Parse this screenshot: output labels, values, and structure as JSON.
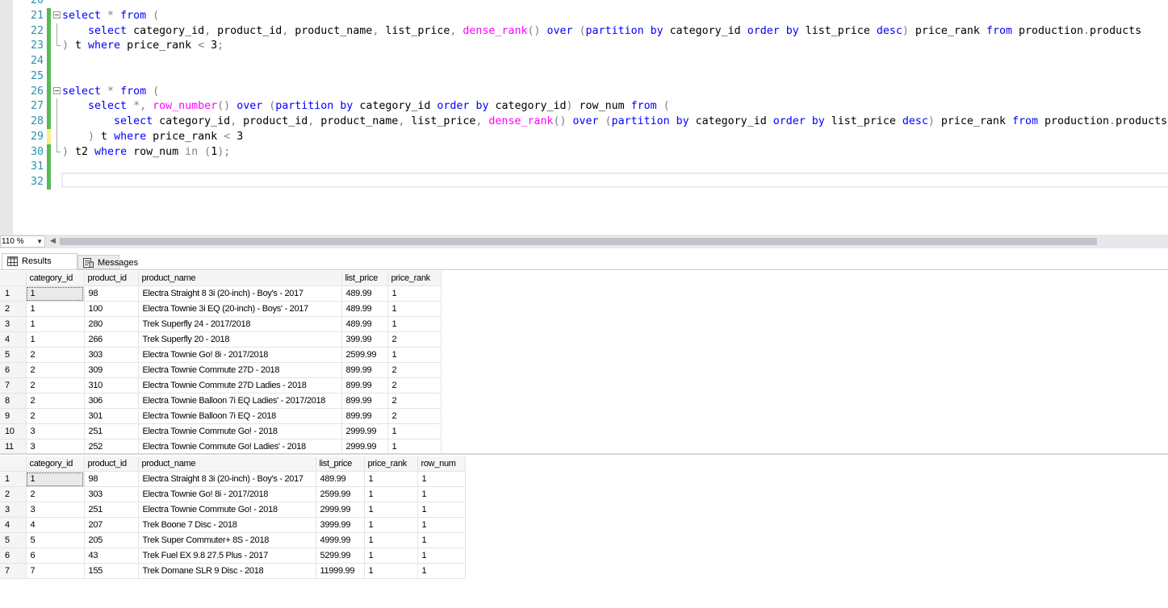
{
  "editor": {
    "lines": [
      {
        "num": "20",
        "tokens": []
      },
      {
        "num": "21",
        "tokens": [
          [
            "kw",
            "select "
          ],
          [
            "op",
            "* "
          ],
          [
            "kw",
            "from "
          ],
          [
            "op",
            "("
          ]
        ]
      },
      {
        "num": "22",
        "tokens": [
          [
            "",
            "    "
          ],
          [
            "kw",
            "select "
          ],
          [
            "",
            "category_id"
          ],
          [
            "op",
            ", "
          ],
          [
            "",
            "product_id"
          ],
          [
            "op",
            ", "
          ],
          [
            "",
            "product_name"
          ],
          [
            "op",
            ", "
          ],
          [
            "",
            "list_price"
          ],
          [
            "op",
            ", "
          ],
          [
            "fn",
            "dense_rank"
          ],
          [
            "op",
            "() "
          ],
          [
            "kw",
            "over "
          ],
          [
            "op",
            "("
          ],
          [
            "kw",
            "partition by "
          ],
          [
            "",
            "category_id "
          ],
          [
            "kw",
            "order by "
          ],
          [
            "",
            "list_price "
          ],
          [
            "kw",
            "desc"
          ],
          [
            "op",
            ") "
          ],
          [
            "",
            "price_rank "
          ],
          [
            "kw",
            "from "
          ],
          [
            "",
            "production"
          ],
          [
            "op",
            "."
          ],
          [
            "",
            "products"
          ]
        ]
      },
      {
        "num": "23",
        "tokens": [
          [
            "op",
            ") "
          ],
          [
            "",
            "t "
          ],
          [
            "kw",
            "where "
          ],
          [
            "",
            "price_rank "
          ],
          [
            "op",
            "< "
          ],
          [
            "",
            "3"
          ],
          [
            "op",
            ";"
          ]
        ]
      },
      {
        "num": "24",
        "tokens": []
      },
      {
        "num": "25",
        "tokens": []
      },
      {
        "num": "26",
        "tokens": [
          [
            "kw",
            "select "
          ],
          [
            "op",
            "* "
          ],
          [
            "kw",
            "from "
          ],
          [
            "op",
            "("
          ]
        ]
      },
      {
        "num": "27",
        "tokens": [
          [
            "",
            "    "
          ],
          [
            "kw",
            "select "
          ],
          [
            "op",
            "*, "
          ],
          [
            "fn",
            "row_number"
          ],
          [
            "op",
            "() "
          ],
          [
            "kw",
            "over "
          ],
          [
            "op",
            "("
          ],
          [
            "kw",
            "partition by "
          ],
          [
            "",
            "category_id "
          ],
          [
            "kw",
            "order by "
          ],
          [
            "",
            "category_id"
          ],
          [
            "op",
            ") "
          ],
          [
            "",
            "row_num "
          ],
          [
            "kw",
            "from "
          ],
          [
            "op",
            "("
          ]
        ]
      },
      {
        "num": "28",
        "tokens": [
          [
            "",
            "        "
          ],
          [
            "kw",
            "select "
          ],
          [
            "",
            "category_id"
          ],
          [
            "op",
            ", "
          ],
          [
            "",
            "product_id"
          ],
          [
            "op",
            ", "
          ],
          [
            "",
            "product_name"
          ],
          [
            "op",
            ", "
          ],
          [
            "",
            "list_price"
          ],
          [
            "op",
            ", "
          ],
          [
            "fn",
            "dense_rank"
          ],
          [
            "op",
            "() "
          ],
          [
            "kw",
            "over "
          ],
          [
            "op",
            "("
          ],
          [
            "kw",
            "partition by "
          ],
          [
            "",
            "category_id "
          ],
          [
            "kw",
            "order by "
          ],
          [
            "",
            "list_price "
          ],
          [
            "kw",
            "desc"
          ],
          [
            "op",
            ") "
          ],
          [
            "",
            "price_rank "
          ],
          [
            "kw",
            "from "
          ],
          [
            "",
            "production"
          ],
          [
            "op",
            "."
          ],
          [
            "",
            "products"
          ]
        ]
      },
      {
        "num": "29",
        "tokens": [
          [
            "",
            "    "
          ],
          [
            "op",
            ") "
          ],
          [
            "",
            "t "
          ],
          [
            "kw",
            "where "
          ],
          [
            "",
            "price_rank "
          ],
          [
            "op",
            "< "
          ],
          [
            "",
            "3"
          ]
        ]
      },
      {
        "num": "30",
        "tokens": [
          [
            "op",
            ") "
          ],
          [
            "",
            "t2 "
          ],
          [
            "kw",
            "where "
          ],
          [
            "",
            "row_num "
          ],
          [
            "op",
            "in "
          ],
          [
            "op",
            "("
          ],
          [
            "",
            "1"
          ],
          [
            "op",
            ");"
          ]
        ]
      },
      {
        "num": "31",
        "tokens": []
      },
      {
        "num": "32",
        "tokens": []
      }
    ]
  },
  "zoom": {
    "value": "110 %"
  },
  "tabs": {
    "results_label": "Results",
    "messages_label": "Messages"
  },
  "grid1": {
    "columns": [
      "category_id",
      "product_id",
      "product_name",
      "list_price",
      "price_rank"
    ],
    "rows": [
      [
        "1",
        "1",
        "98",
        "Electra Straight 8 3i (20-inch) - Boy's - 2017",
        "489.99",
        "1"
      ],
      [
        "2",
        "1",
        "100",
        "Electra Townie 3i EQ (20-inch) - Boys' - 2017",
        "489.99",
        "1"
      ],
      [
        "3",
        "1",
        "280",
        "Trek Superfly 24 - 2017/2018",
        "489.99",
        "1"
      ],
      [
        "4",
        "1",
        "266",
        "Trek Superfly 20 - 2018",
        "399.99",
        "2"
      ],
      [
        "5",
        "2",
        "303",
        "Electra Townie Go! 8i - 2017/2018",
        "2599.99",
        "1"
      ],
      [
        "6",
        "2",
        "309",
        "Electra Townie Commute 27D - 2018",
        "899.99",
        "2"
      ],
      [
        "7",
        "2",
        "310",
        "Electra Townie Commute 27D Ladies - 2018",
        "899.99",
        "2"
      ],
      [
        "8",
        "2",
        "306",
        "Electra Townie Balloon 7i EQ Ladies' - 2017/2018",
        "899.99",
        "2"
      ],
      [
        "9",
        "2",
        "301",
        "Electra Townie Balloon 7i EQ - 2018",
        "899.99",
        "2"
      ],
      [
        "10",
        "3",
        "251",
        "Electra Townie Commute Go! - 2018",
        "2999.99",
        "1"
      ],
      [
        "11",
        "3",
        "252",
        "Electra Townie Commute Go! Ladies' - 2018",
        "2999.99",
        "1"
      ]
    ]
  },
  "grid2": {
    "columns": [
      "category_id",
      "product_id",
      "product_name",
      "list_price",
      "price_rank",
      "row_num"
    ],
    "rows": [
      [
        "1",
        "1",
        "98",
        "Electra Straight 8 3i (20-inch) - Boy's - 2017",
        "489.99",
        "1",
        "1"
      ],
      [
        "2",
        "2",
        "303",
        "Electra Townie Go! 8i - 2017/2018",
        "2599.99",
        "1",
        "1"
      ],
      [
        "3",
        "3",
        "251",
        "Electra Townie Commute Go! - 2018",
        "2999.99",
        "1",
        "1"
      ],
      [
        "4",
        "4",
        "207",
        "Trek Boone 7 Disc - 2018",
        "3999.99",
        "1",
        "1"
      ],
      [
        "5",
        "5",
        "205",
        "Trek Super Commuter+ 8S - 2018",
        "4999.99",
        "1",
        "1"
      ],
      [
        "6",
        "6",
        "43",
        "Trek Fuel EX 9.8 27.5 Plus - 2017",
        "5299.99",
        "1",
        "1"
      ],
      [
        "7",
        "7",
        "155",
        "Trek Domane SLR 9 Disc - 2018",
        "11999.99",
        "1",
        "1"
      ]
    ]
  }
}
